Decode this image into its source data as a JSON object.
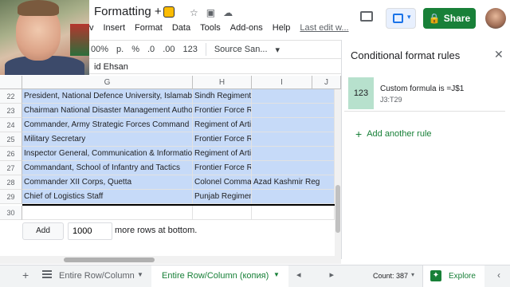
{
  "header": {
    "title": "Formatting",
    "plus_dollar": "+ $",
    "menu": [
      "v",
      "Insert",
      "Format",
      "Data",
      "Tools",
      "Add-ons",
      "Help",
      "Last edit w..."
    ],
    "share_label": "Share"
  },
  "toolbar": {
    "zoom": "00%",
    "currency": "p.",
    "percent": "%",
    "dec_less": ".0",
    "dec_more": ".00",
    "format": "123",
    "font": "Source San..."
  },
  "formula_bar": {
    "value": "id Ehsan"
  },
  "grid": {
    "columns": [
      "G",
      "H",
      "I",
      "J"
    ],
    "rows": [
      {
        "num": "22",
        "g": "President, National Defence University, Islamabad",
        "h": "Sindh Regiment",
        "i": ""
      },
      {
        "num": "23",
        "g": "Chairman National Disaster Management Authority",
        "h": "Frontier Force Regiment",
        "i": ""
      },
      {
        "num": "24",
        "g": "Commander, Army Strategic Forces Command",
        "h": "Regiment of Artillery",
        "i": ""
      },
      {
        "num": "25",
        "g": "Military Secretary",
        "h": "Frontier Force Regiment",
        "i": ""
      },
      {
        "num": "26",
        "g": "Inspector General, Communication & Information Tec",
        "h": "Regiment of Artillery",
        "i": ""
      },
      {
        "num": "27",
        "g": "Commandant, School of Infantry and Tactics",
        "h": "Frontier Force Regiment",
        "i": ""
      },
      {
        "num": "28",
        "g": "Commander XII Corps, Quetta",
        "h": "Colonel Comman",
        "i": "Azad Kashmir Reg"
      },
      {
        "num": "29",
        "g": "Chief of Logistics Staff",
        "h": "Punjab Regiment",
        "i": ""
      },
      {
        "num": "30",
        "g": "",
        "h": "",
        "i": ""
      }
    ],
    "add_label": "Add",
    "add_rows_value": "1000",
    "add_rows_suffix": "more rows at bottom."
  },
  "panel": {
    "title": "Conditional format rules",
    "rule_preview": "123",
    "rule_text": "Custom formula is =J$1",
    "rule_range": "J3:T29",
    "add_rule": "Add another rule"
  },
  "bottom": {
    "tab1": "Entire Row/Column",
    "tab2": "Entire Row/Column (копия)",
    "count": "Count: 387",
    "explore": "Explore"
  },
  "colors": {
    "accent": "#188038",
    "highlight": "#c6daf8",
    "swatch": "#b7e1cd"
  }
}
